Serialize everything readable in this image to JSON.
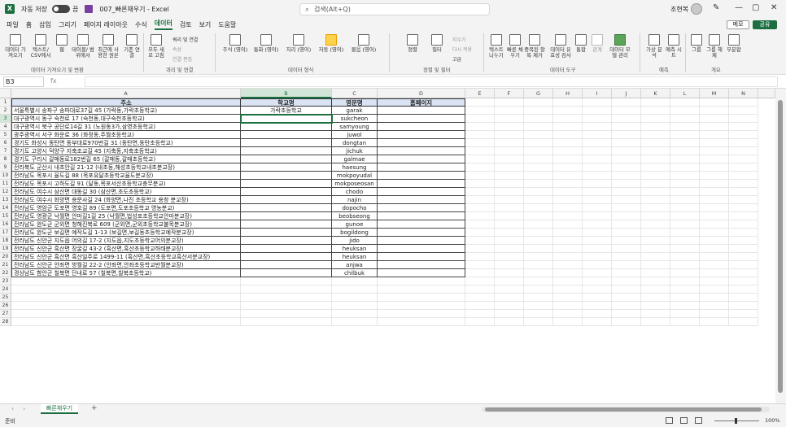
{
  "window": {
    "autosave_label": "자동 저장",
    "autosave_state": "끔",
    "filename": "007_빠른채우기 - Excel",
    "search_placeholder": "검색(Alt+Q)",
    "user_name": "조현복",
    "minimize": "—",
    "maximize": "▢",
    "close": "✕"
  },
  "menu": {
    "items": [
      "파일",
      "홈",
      "삽입",
      "그리기",
      "페이지 레이아웃",
      "수식",
      "데이터",
      "검토",
      "보기",
      "도움말"
    ],
    "active": "데이터",
    "memo_label": "메모",
    "share_label": "공유"
  },
  "ribbon": {
    "groups": {
      "get": "데이터 가져오기 및 변환",
      "query": "쿼리 및 연결",
      "types": "데이터 형식",
      "sort": "정렬 및 필터",
      "tools": "데이터 도구",
      "forecast": "예측",
      "outline": "개요"
    },
    "buttons": {
      "get_data": "데이터 가 져오기",
      "text_csv": "텍스트/ CSV에서",
      "web": "웹",
      "table_range": "테이블/ 범위에서",
      "recent": "최근에 사 용한 원본",
      "existing": "기존 연결",
      "refresh": "모두 새로 고침",
      "queries": "쿼리 및 연결",
      "properties": "속성",
      "edit_links": "연결 편집",
      "stocks": "주식 (영어)",
      "currency": "통화 (영어)",
      "geo": "지리 (영어)",
      "auto": "자동 (영어)",
      "more": "물음 (영어)",
      "sort": "정렬",
      "filter": "필터",
      "clear": "지우기",
      "reapply": "다시 적용",
      "advanced": "고급",
      "text_to_col": "텍스트 나누기",
      "flash_fill": "빠른 채우기",
      "remove_dup": "중복된 항목 제거",
      "validation": "데이터 유효성 검사",
      "consolidate": "통합",
      "relations": "관계",
      "model": "데이터 모델 관리",
      "whatif": "가상 분석",
      "forecast": "예측 시트",
      "group": "그룹",
      "ungroup": "그룹 해제",
      "subtotal": "부분합"
    }
  },
  "formula": {
    "cell_ref": "B3",
    "fx": "fx",
    "value": ""
  },
  "grid": {
    "columns": [
      "A",
      "B",
      "C",
      "D",
      "E",
      "F",
      "G",
      "H",
      "I",
      "J",
      "K",
      "L",
      "M",
      "N"
    ],
    "selected_column": "B",
    "selected_row": 3,
    "header": {
      "address": "주소",
      "school": "학교명",
      "eng": "영문명",
      "homepage": "홈페이지"
    },
    "rows": [
      {
        "address": "서울특별시 송파구 송파대로37길 45 (가락동,가락초등학교)",
        "school": "가락초등학교",
        "eng": "garak"
      },
      {
        "address": "대구광역시 동구 숙천로 17 (숙천동,대구숙천초등학교)",
        "school": "",
        "eng": "sukcheon"
      },
      {
        "address": "대구광역시 북구 공단로14길 31 (노원동3가,삼영초등학교)",
        "school": "",
        "eng": "samyoung"
      },
      {
        "address": "광주광역시 서구 화운로 36 (화정동,주월초등학교)",
        "school": "",
        "eng": "juwol"
      },
      {
        "address": "경기도 화성시 동탄면 동부대로970번길 31 (동탄면,동탄초등학교)",
        "school": "",
        "eng": "dongtan"
      },
      {
        "address": "경기도 고양시 덕양구 지축조교길 45 (지축동,지축초등학교)",
        "school": "",
        "eng": "jichuk"
      },
      {
        "address": "경기도 구리시 갈매동로182번길 65 (갈매동,갈매초등학교)",
        "school": "",
        "eng": "galmae"
      },
      {
        "address": "전라북도 군산시 내초안길 21-12 (내초동,해성초등학교내초분교장)",
        "school": "",
        "eng": "haesung"
      },
      {
        "address": "전라남도 목포시 율도길 88  (목포유달초등학교율도분교장)",
        "school": "",
        "eng": "mokpoyudal"
      },
      {
        "address": "전라남도 목포시 고하도길 91 (달동,목포서산초등학교충무분교)",
        "school": "",
        "eng": "mokposeosan"
      },
      {
        "address": "전라남도 여수시 삼산면 대동길 30 (삼산면,초도초등학교)",
        "school": "",
        "eng": "chodo"
      },
      {
        "address": "전라남도 여수시 화양면 용문사길 24 (화양면,나진 초등학교 용창 분교장)",
        "school": "",
        "eng": "najin"
      },
      {
        "address": "전라남도 영암군 도포면 영호길 89 (도포면,도포초등학교 영농분교)",
        "school": "",
        "eng": "dopocho"
      },
      {
        "address": "전라남도 영광군 낙월면 안마길1길 25 (낙월면,법성포초등학교안마분교장)",
        "school": "",
        "eng": "beobseong"
      },
      {
        "address": "전라남도 완도군 군외면 청해진북로 609 (군외면,군외초등학교불목분교장)",
        "school": "",
        "eng": "gunoe"
      },
      {
        "address": "전라남도 완도군 보길면 예작도길 1-13 (보길면,보길동초등학교예작분교장)",
        "school": "",
        "eng": "bogildong"
      },
      {
        "address": "전라남도 신안군 지도읍 어의길 17-2 (지도읍,지도초등학교어의분교장)",
        "school": "",
        "eng": "jido"
      },
      {
        "address": "전라남도 신안군 흑산면 장굴길 43-2 (흑산면,흑산초등학교하태분교장)",
        "school": "",
        "eng": "heuksan"
      },
      {
        "address": "전라남도 신안군 흑산면 흑산일주로 1499-11 (흑산면,흑산초등학교흑산서분교장)",
        "school": "",
        "eng": "heuksan"
      },
      {
        "address": "전라남도 신안군 안좌면 방월길 22-2  (안좌면,안좌초등학교반월분교장)",
        "school": "",
        "eng": "anjwa"
      },
      {
        "address": "경상남도 함안군 칠북면 단내로 57 (칠북면,칠북초등학교)",
        "school": "",
        "eng": "chilbuk"
      }
    ],
    "row_count": 28
  },
  "sheet": {
    "tab_label": "빠른채우기",
    "add_label": "+"
  },
  "status": {
    "mode": "준비",
    "zoom": "100%"
  },
  "colors": {
    "excel_green": "#1d6f42",
    "header_fill": "#dae3f3"
  }
}
